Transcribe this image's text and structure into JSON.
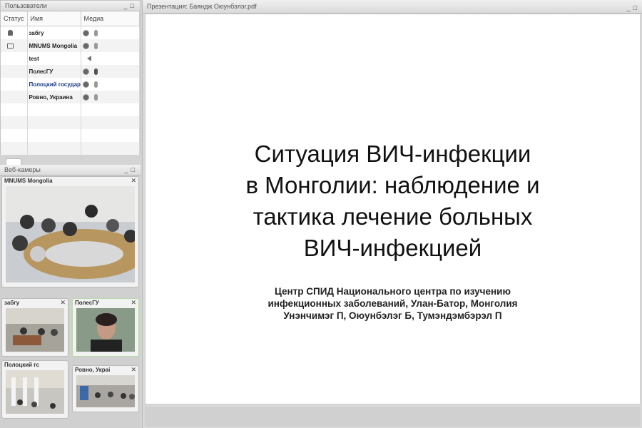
{
  "users_panel": {
    "title": "Пользователи",
    "columns": [
      "Статус",
      "Имя",
      "Медиа"
    ],
    "rows": [
      {
        "status_icon": "person-icon",
        "name": "забгу",
        "media": [
          "webcam-icon",
          "mic-icon"
        ]
      },
      {
        "status_icon": "presenter-icon",
        "name": "MNUMS Mongolia",
        "media": [
          "webcam-icon",
          "mic-icon"
        ]
      },
      {
        "status_icon": "",
        "name": "test",
        "media": [
          "speaker-icon"
        ]
      },
      {
        "status_icon": "",
        "name": "ПолесГУ",
        "media": [
          "webcam-icon",
          "mic-icon"
        ]
      },
      {
        "status_icon": "",
        "name": "Полоцкий государ",
        "media": [
          "webcam-icon",
          "mic-icon"
        ]
      },
      {
        "status_icon": "",
        "name": "Ровно, Украина",
        "media": [
          "webcam-icon",
          "mic-icon"
        ]
      }
    ],
    "window_buttons": [
      "_",
      "□"
    ]
  },
  "webcams_panel": {
    "title": "Веб-камеры",
    "cams": [
      {
        "title": "MNUMS Mongolia"
      },
      {
        "title": "забгу"
      },
      {
        "title": "ПолесГУ"
      },
      {
        "title": "Полоцкий гс"
      },
      {
        "title": "Ровно, Украі"
      }
    ],
    "close_glyph": "✕"
  },
  "presentation": {
    "window_title": "Презентация: Баяндж Оюунбэлэг.pdf",
    "slide_title_lines": [
      "Ситуация ВИЧ-инфекции",
      "в Монголии: наблюдение и",
      "тактика лечение больных",
      "ВИЧ-инфекцией"
    ],
    "slide_sub_lines": [
      "Центр СПИД Национального центра по изучению",
      "инфекционных заболеваний, Улан-Батор, Монголия",
      "Унэнчимэг П, Оюунбэлэг Б, Тумэндэмбэрэл П"
    ]
  }
}
